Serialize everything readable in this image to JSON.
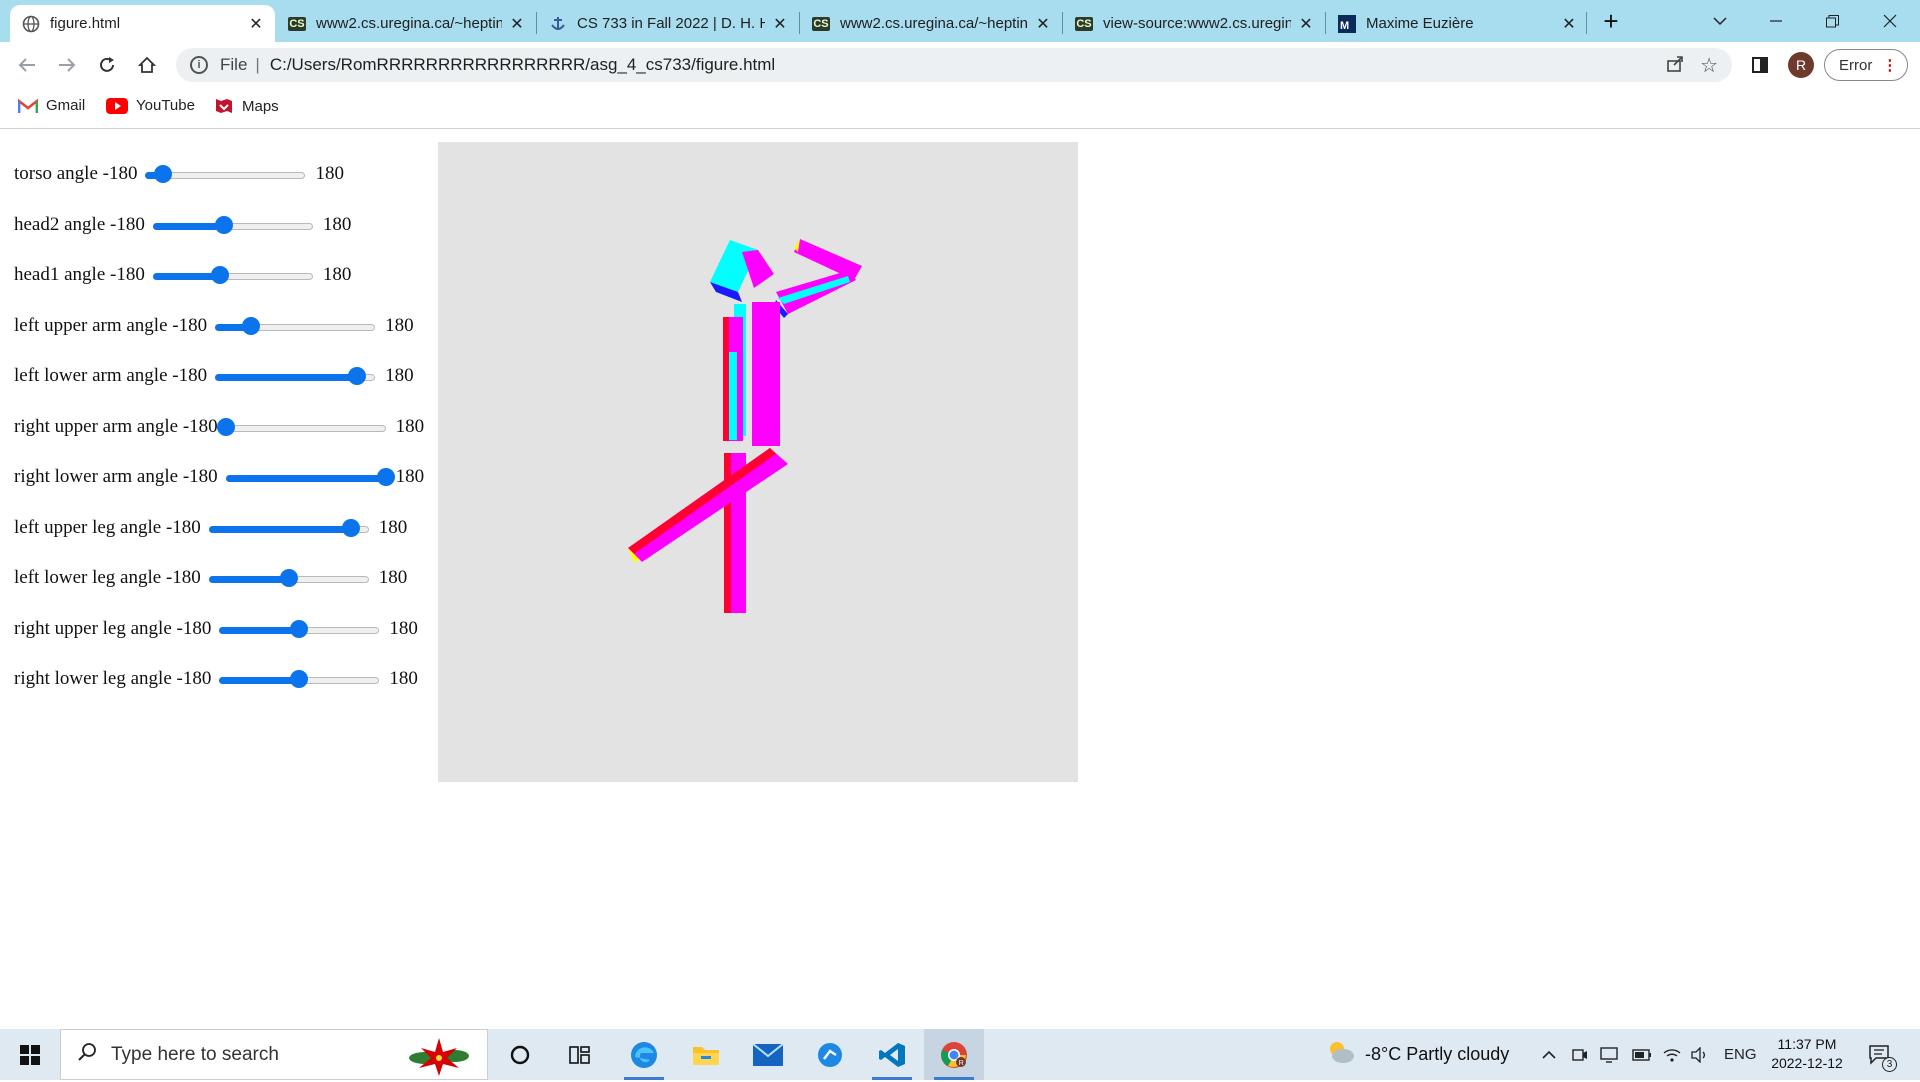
{
  "browser": {
    "tabs": [
      {
        "title": "figure.html",
        "active": true,
        "favicon": "globe-icon"
      },
      {
        "title": "www2.cs.uregina.ca/~heptin",
        "active": false,
        "favicon": "cs-icon"
      },
      {
        "title": "CS 733 in Fall 2022 | D. H. H",
        "active": false,
        "favicon": "anchor-icon"
      },
      {
        "title": "www2.cs.uregina.ca/~heptin",
        "active": false,
        "favicon": "cs-icon"
      },
      {
        "title": "view-source:www2.cs.uregin",
        "active": false,
        "favicon": "cs-icon"
      },
      {
        "title": "Maxime Euzière",
        "active": false,
        "favicon": "maxime-icon"
      }
    ],
    "address": {
      "scheme": "File",
      "url": "C:/Users/RomRRRRRRRRRRRRRRRRR/asg_4_cs733/figure.html"
    },
    "profile_initial": "R",
    "error_label": "Error",
    "bookmarks": [
      {
        "label": "Gmail",
        "icon": "gmail-icon"
      },
      {
        "label": "YouTube",
        "icon": "youtube-icon"
      },
      {
        "label": "Maps",
        "icon": "maps-icon"
      }
    ]
  },
  "controls": [
    {
      "label": "torso angle",
      "min": "-180",
      "max": "180",
      "value": -140
    },
    {
      "label": "head2 angle",
      "min": "-180",
      "max": "180",
      "value": -20
    },
    {
      "label": "head1 angle",
      "min": "-180",
      "max": "180",
      "value": -30
    },
    {
      "label": "left upper arm angle",
      "min": "-180",
      "max": "180",
      "value": -100
    },
    {
      "label": "left lower arm angle",
      "min": "-180",
      "max": "180",
      "value": 140
    },
    {
      "label": "right upper arm angle",
      "min": "-180",
      "max": "180",
      "value": -180
    },
    {
      "label": "right lower arm angle",
      "min": "-180",
      "max": "180",
      "value": 180
    },
    {
      "label": "left upper leg angle",
      "min": "-180",
      "max": "180",
      "value": 140
    },
    {
      "label": "left lower leg angle",
      "min": "-180",
      "max": "180",
      "value": 0
    },
    {
      "label": "right upper leg angle",
      "min": "-180",
      "max": "180",
      "value": 0
    },
    {
      "label": "right lower leg angle",
      "min": "-180",
      "max": "180",
      "value": 0
    }
  ],
  "colors": {
    "accent": "#0b74ec",
    "canvas_bg": "#e3e3e3",
    "magenta": "#ff00ff",
    "cyan": "#00ffff",
    "red": "#ff0033",
    "blue": "#0000ff",
    "yellow": "#ffff00"
  },
  "taskbar": {
    "search_placeholder": "Type here to search",
    "weather": "-8°C  Partly cloudy",
    "language": "ENG",
    "time": "11:37 PM",
    "date": "2022-12-12",
    "notification_count": "3",
    "apps": [
      "cortana-icon",
      "task-view-icon",
      "edge-icon",
      "file-explorer-icon",
      "mail-icon",
      "app-icon",
      "vscode-icon",
      "chrome-icon"
    ]
  }
}
